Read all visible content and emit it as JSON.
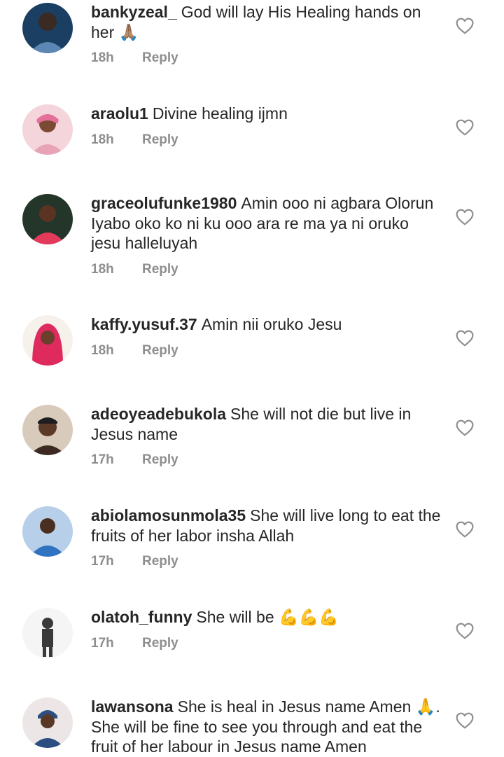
{
  "comments": [
    {
      "username": "bankyzeal_",
      "text": "God will lay His Healing hands on her 🙏🏽",
      "time": "18h",
      "reply_label": "Reply",
      "avatar_colors": [
        "#1b3f63",
        "#5c86b4"
      ]
    },
    {
      "username": "araolu1",
      "text": "Divine healing ijmn",
      "time": "18h",
      "reply_label": "Reply",
      "avatar_colors": [
        "#f4d5dc",
        "#e8a3b6"
      ]
    },
    {
      "username": "graceolufunke1980",
      "text": "Amin ooo ni agbara Olorun Iyabo oko ko ni ku ooo ara re ma ya ni oruko jesu halleluyah",
      "time": "18h",
      "reply_label": "Reply",
      "avatar_colors": [
        "#24362a",
        "#e33a5b"
      ]
    },
    {
      "username": "kaffy.yusuf.37",
      "text": "Amin nii oruko Jesu",
      "time": "18h",
      "reply_label": "Reply",
      "avatar_colors": [
        "#f7f1ec",
        "#de2a5d"
      ]
    },
    {
      "username": "adeoyeadebukola",
      "text": "She will not die but live in Jesus name",
      "time": "17h",
      "reply_label": "Reply",
      "avatar_colors": [
        "#d9cbbb",
        "#3d2b23"
      ]
    },
    {
      "username": "abiolamosunmola35",
      "text": "She will live long to eat the fruits of her labor insha Allah",
      "time": "17h",
      "reply_label": "Reply",
      "avatar_colors": [
        "#b7cfe8",
        "#2f73c1"
      ]
    },
    {
      "username": "olatoh_funny",
      "text": "She will be 💪💪💪",
      "time": "17h",
      "reply_label": "Reply",
      "avatar_colors": [
        "#f5f5f5",
        "#3a3a3a"
      ]
    },
    {
      "username": "lawansona",
      "text": "She is heal in Jesus name Amen 🙏. She will be fine to see you through and eat the fruit of her labour in Jesus name Amen",
      "time": "",
      "reply_label": "",
      "avatar_colors": [
        "#ece7e6",
        "#2a4f80"
      ]
    }
  ]
}
